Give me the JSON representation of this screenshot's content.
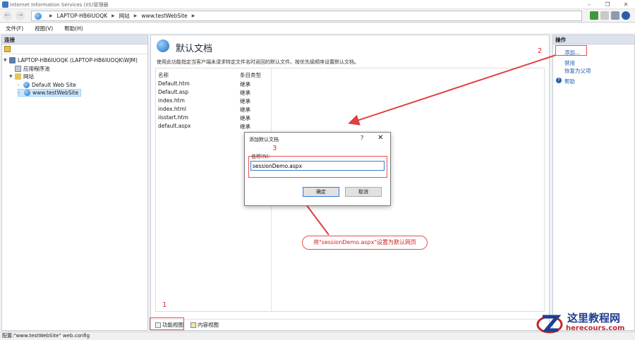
{
  "window": {
    "title": "Internet Information Services (IIS)管理器"
  },
  "address": {
    "server": "LAPTOP-HB6IUOQK",
    "sites": "网站",
    "site": "www.testWebSite"
  },
  "menu": [
    "文件(F)",
    "视图(V)",
    "帮助(H)"
  ],
  "connections": {
    "header": "连接",
    "tree": {
      "server": "LAPTOP-HB6IUOQK (LAPTOP-HB6IUOQK\\WJM)",
      "app_pools": "应用程序池",
      "sites": "网站",
      "default_site": "Default Web Site",
      "test_site": "www.testWebSite"
    }
  },
  "main": {
    "title": "默认文档",
    "description": "使用此功能指定当客户端未请求特定文件名时返回的默认文件。按优先级顺序设置默认文档。",
    "columns": {
      "name": "名称",
      "type": "条目类型"
    },
    "rows": [
      {
        "name": "Default.htm",
        "type": "继承"
      },
      {
        "name": "Default.asp",
        "type": "继承"
      },
      {
        "name": "index.htm",
        "type": "继承"
      },
      {
        "name": "index.html",
        "type": "继承"
      },
      {
        "name": "iisstart.htm",
        "type": "继承"
      },
      {
        "name": "default.aspx",
        "type": "继承"
      }
    ],
    "tabs": {
      "features": "功能视图",
      "content": "内容视图"
    }
  },
  "actions": {
    "header": "操作",
    "add": "添加...",
    "disable": "禁用",
    "revert": "恢复为父项",
    "help": "帮助"
  },
  "status": "配置:\"www.testWebSite\" web.config",
  "dialog": {
    "title": "添加默认文档",
    "help": "?",
    "close": "✕",
    "label": "名称(N):",
    "value": "sessionDemo.aspx",
    "ok": "确定",
    "cancel": "取消"
  },
  "annotations": {
    "n1": "1",
    "n2": "2",
    "n3": "3",
    "callout": "将\"sessionDemo.aspx\"设置为默认网页",
    "color": "#e03030"
  },
  "watermark": {
    "name": "这里教程网",
    "url": "herecours.com"
  }
}
